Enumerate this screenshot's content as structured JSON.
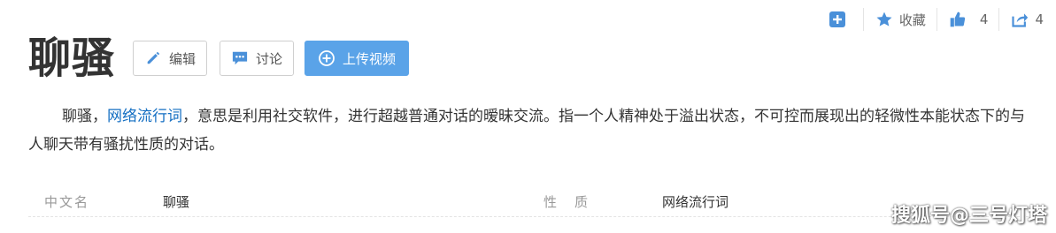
{
  "toolbar": {
    "collect_label": "收藏",
    "like_count": "4",
    "share_count": "4"
  },
  "title": "聊骚",
  "buttons": {
    "edit": "编辑",
    "discuss": "讨论",
    "upload": "上传视频"
  },
  "summary": {
    "part1": "聊骚，",
    "link": "网络流行词",
    "part2": "，意思是利用社交软件，进行超越普通对话的暧昧交流。指一个人精神处于溢出状态，不可控而展现出的轻微性本能状态下的与人聊天带有骚扰性质的对话。"
  },
  "info": {
    "label1": "中文名",
    "value1": "聊骚",
    "label2": "性质",
    "value2": "网络流行词"
  },
  "watermark": "搜狐号@三号灯塔",
  "colors": {
    "accent": "#5aa3e8",
    "link": "#136ec2",
    "icon_blue": "#4a90d9"
  }
}
